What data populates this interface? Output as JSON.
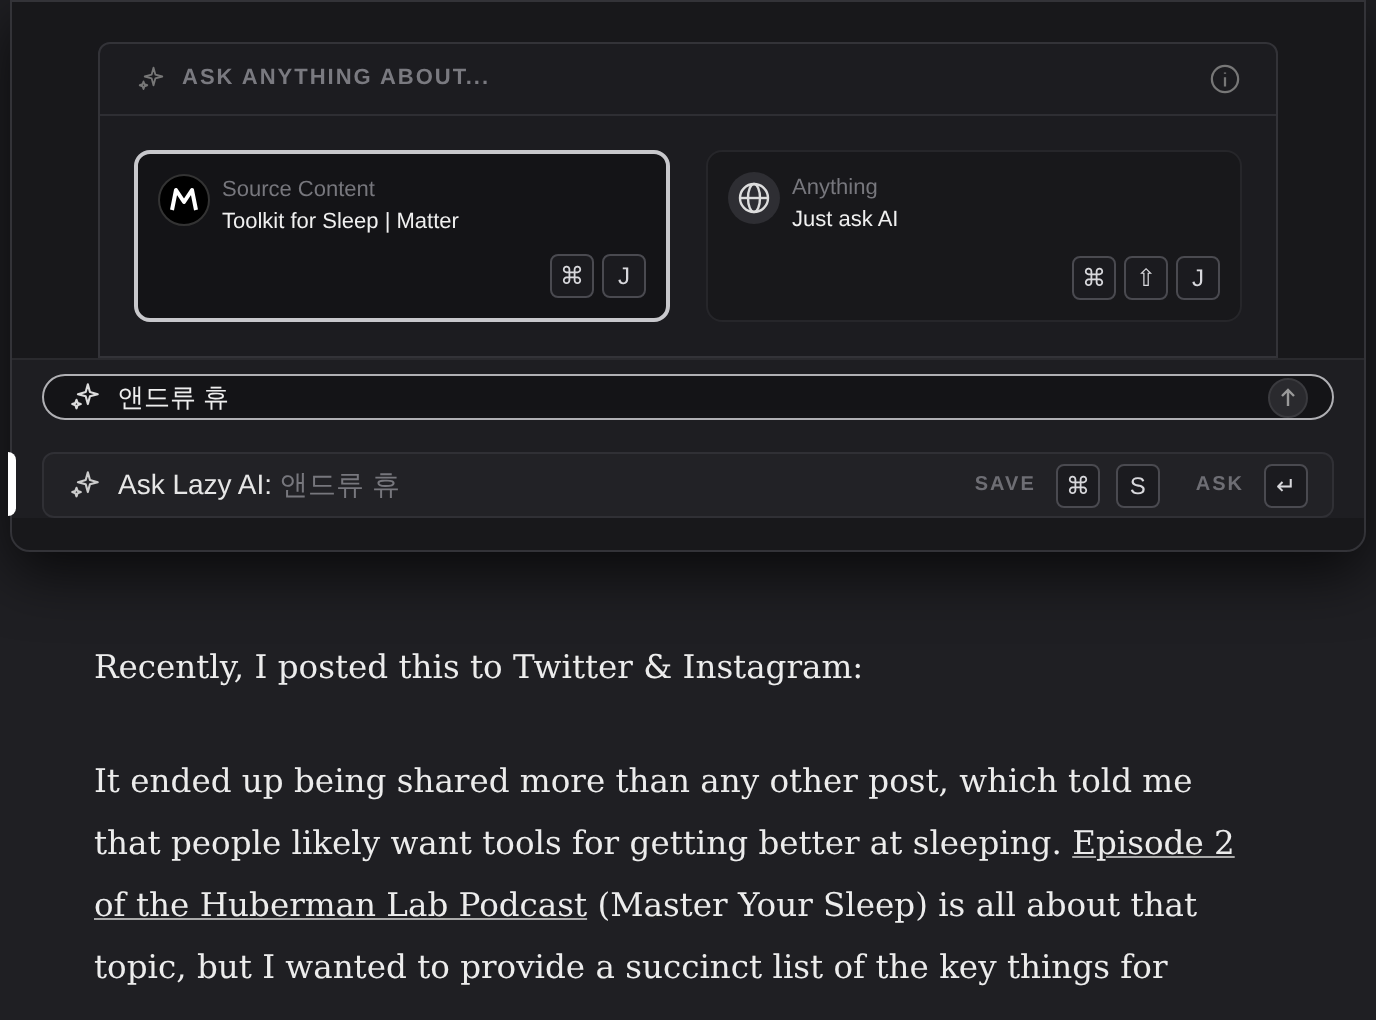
{
  "header": {
    "title": "ASK ANYTHING ABOUT..."
  },
  "sources": [
    {
      "kind": "source",
      "label": "Source Content",
      "title": "Toolkit for Sleep | Matter",
      "selected": true,
      "keys": [
        "⌘",
        "J"
      ]
    },
    {
      "kind": "anything",
      "label": "Anything",
      "title": "Just ask AI",
      "selected": false,
      "keys": [
        "⌘",
        "⇧",
        "J"
      ]
    }
  ],
  "input": {
    "value": "앤드류 휴"
  },
  "suggestion": {
    "prefix": "Ask Lazy AI:",
    "query": "앤드류 휴",
    "save_label": "SAVE",
    "save_keys": [
      "⌘",
      "S"
    ],
    "ask_label": "ASK",
    "ask_keys": [
      "↵"
    ],
    "selected": true
  },
  "article": [
    {
      "lines": [
        [
          {
            "text": "Recently, I posted this to Twitter & Instagram:"
          }
        ]
      ]
    },
    {
      "lines": [
        [
          {
            "text": "It ended up being shared more than any other post, which told me"
          }
        ],
        [
          {
            "text": "that people likely want tools for getting better at sleeping. "
          },
          {
            "text": "Episode 2",
            "link": true
          }
        ],
        [
          {
            "text": "of the Huberman Lab Podcast",
            "link": true
          },
          {
            "text": " (Master Your Sleep) is all about that"
          }
        ],
        [
          {
            "text": "topic, but I wanted to provide a succinct list of the key things for"
          }
        ]
      ]
    }
  ]
}
